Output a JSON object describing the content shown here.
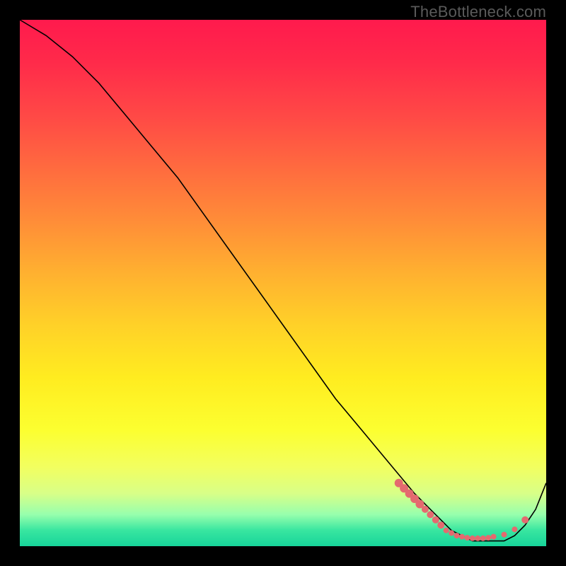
{
  "watermark": "TheBottleneck.com",
  "chart_data": {
    "type": "line",
    "title": "",
    "xlabel": "",
    "ylabel": "",
    "xlim": [
      0,
      100
    ],
    "ylim": [
      0,
      100
    ],
    "grid": false,
    "legend": false,
    "series": [
      {
        "name": "bottleneck-curve",
        "x": [
          0,
          5,
          10,
          15,
          20,
          25,
          30,
          35,
          40,
          45,
          50,
          55,
          60,
          65,
          70,
          75,
          78,
          80,
          82,
          84,
          86,
          88,
          90,
          92,
          94,
          96,
          98,
          100
        ],
        "y": [
          100,
          97,
          93,
          88,
          82,
          76,
          70,
          63,
          56,
          49,
          42,
          35,
          28,
          22,
          16,
          10,
          7,
          5,
          3,
          2,
          1,
          1,
          1,
          1,
          2,
          4,
          7,
          12
        ]
      }
    ],
    "markers": {
      "name": "highlight-dots",
      "x": [
        72,
        73,
        74,
        75,
        76,
        77,
        78,
        79,
        80,
        81,
        82,
        83,
        84,
        85,
        86,
        87,
        88,
        89,
        90,
        92,
        94,
        96
      ],
      "y": [
        12,
        11,
        10,
        9,
        8,
        7,
        6,
        5,
        4,
        3,
        2.5,
        2,
        1.8,
        1.6,
        1.5,
        1.5,
        1.5,
        1.6,
        1.8,
        2.2,
        3.2,
        5
      ],
      "radii": [
        6,
        6,
        6,
        6,
        6,
        5,
        5,
        5,
        5,
        4,
        4,
        4,
        4,
        4,
        4,
        4,
        4,
        4,
        4,
        4,
        4,
        5
      ]
    }
  }
}
